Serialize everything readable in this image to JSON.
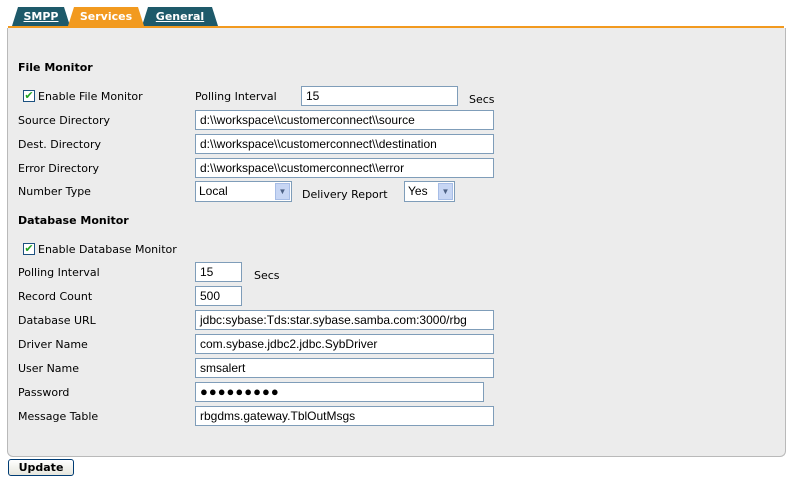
{
  "tabs": [
    {
      "label": "SMPP"
    },
    {
      "label": "Services"
    },
    {
      "label": "General"
    }
  ],
  "file_monitor": {
    "heading": "File Monitor",
    "enable_label": "Enable File Monitor",
    "enabled": true,
    "polling_label": "Polling Interval",
    "polling_value": "15",
    "polling_unit": "Secs",
    "source_label": "Source Directory",
    "source_value": "d:\\\\workspace\\\\customerconnect\\\\source",
    "dest_label": "Dest. Directory",
    "dest_value": "d:\\\\workspace\\\\customerconnect\\\\destination",
    "error_label": "Error Directory",
    "error_value": "d:\\\\workspace\\\\customerconnect\\\\error",
    "number_type_label": "Number Type",
    "number_type_value": "Local",
    "delivery_label": "Delivery Report",
    "delivery_value": "Yes"
  },
  "database_monitor": {
    "heading": "Database Monitor",
    "enable_label": "Enable Database Monitor",
    "enabled": true,
    "polling_label": "Polling Interval",
    "polling_value": "15",
    "polling_unit": "Secs",
    "record_count_label": "Record Count",
    "record_count_value": "500",
    "url_label": "Database URL",
    "url_value": "jdbc:sybase:Tds:star.sybase.samba.com:3000/rbg",
    "driver_label": "Driver Name",
    "driver_value": "com.sybase.jdbc2.jdbc.SybDriver",
    "user_label": "User Name",
    "user_value": "smsalert",
    "password_label": "Password",
    "password_value": "●●●●●●●●●",
    "table_label": "Message Table",
    "table_value": "rbgdms.gateway.TblOutMsgs"
  },
  "update_button": "Update",
  "colors": {
    "tab_active": "#f29a1f",
    "tab_inactive": "#1e5a6a",
    "panel_bg": "#ececec"
  }
}
